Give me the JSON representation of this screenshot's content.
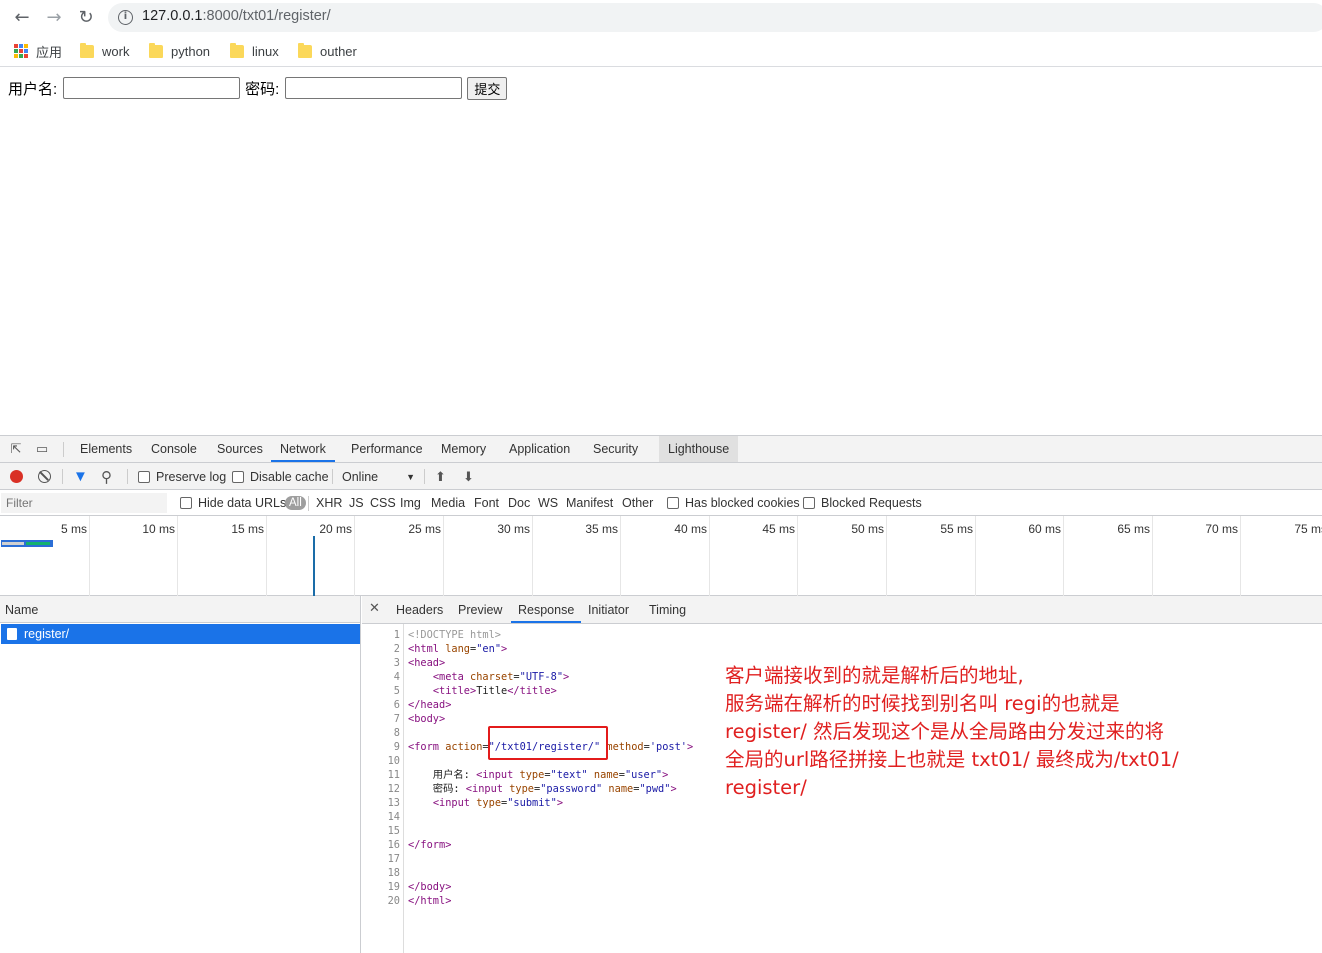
{
  "browser": {
    "url_host": "127.0.0.1",
    "url_rest": ":8000/txt01/register/",
    "bookmarks": [
      {
        "label": "应用",
        "icon": "apps-icon"
      },
      {
        "label": "work",
        "icon": "folder-icon"
      },
      {
        "label": "python",
        "icon": "folder-icon"
      },
      {
        "label": "linux",
        "icon": "folder-icon"
      },
      {
        "label": "outher",
        "icon": "folder-icon"
      }
    ]
  },
  "page": {
    "username_label": "用户名:",
    "password_label": "密码:",
    "submit_label": "提交"
  },
  "devtools": {
    "tabs": [
      "Elements",
      "Console",
      "Sources",
      "Network",
      "Performance",
      "Memory",
      "Application",
      "Security",
      "Lighthouse"
    ],
    "active_tab": "Network",
    "toolbar": {
      "preserve_log": "Preserve log",
      "disable_cache": "Disable cache",
      "throttle": "Online"
    },
    "filter": {
      "placeholder": "Filter",
      "hide_data_urls": "Hide data URLs",
      "all": "All",
      "types": [
        "XHR",
        "JS",
        "CSS",
        "Img",
        "Media",
        "Font",
        "Doc",
        "WS",
        "Manifest",
        "Other"
      ],
      "has_blocked_cookies": "Has blocked cookies",
      "blocked_requests": "Blocked Requests"
    },
    "timeline_ticks": [
      "5 ms",
      "10 ms",
      "15 ms",
      "20 ms",
      "25 ms",
      "30 ms",
      "35 ms",
      "40 ms",
      "45 ms",
      "50 ms",
      "55 ms",
      "60 ms",
      "65 ms",
      "70 ms",
      "75 ms"
    ],
    "name_header": "Name",
    "requests": [
      {
        "name": "register/",
        "selected": true
      }
    ],
    "detail_tabs": [
      "Headers",
      "Preview",
      "Response",
      "Initiator",
      "Timing"
    ],
    "active_detail_tab": "Response",
    "response_lines": [
      "<!DOCTYPE html>",
      "<html lang=\"en\">",
      "<head>",
      "    <meta charset=\"UTF-8\">",
      "    <title>Title</title>",
      "</head>",
      "<body>",
      "",
      "<form action=\"/txt01/register/\" method='post'>",
      "",
      "    用户名: <input type=\"text\" name=\"user\">",
      "    密码: <input type=\"password\" name=\"pwd\">",
      "    <input type=\"submit\">",
      "",
      "",
      "</form>",
      "",
      "",
      "</body>",
      "</html>"
    ]
  },
  "annotation": {
    "lines": [
      "客户端接收到的就是解析后的地址,",
      "服务端在解析的时候找到别名叫  regi的也就是",
      "register/ 然后发现这个是从全局路由分发过来的将",
      "全局的url路径拼接上也就是 txt01/ 最终成为/txt01/",
      "register/"
    ],
    "color": "#e02020"
  }
}
